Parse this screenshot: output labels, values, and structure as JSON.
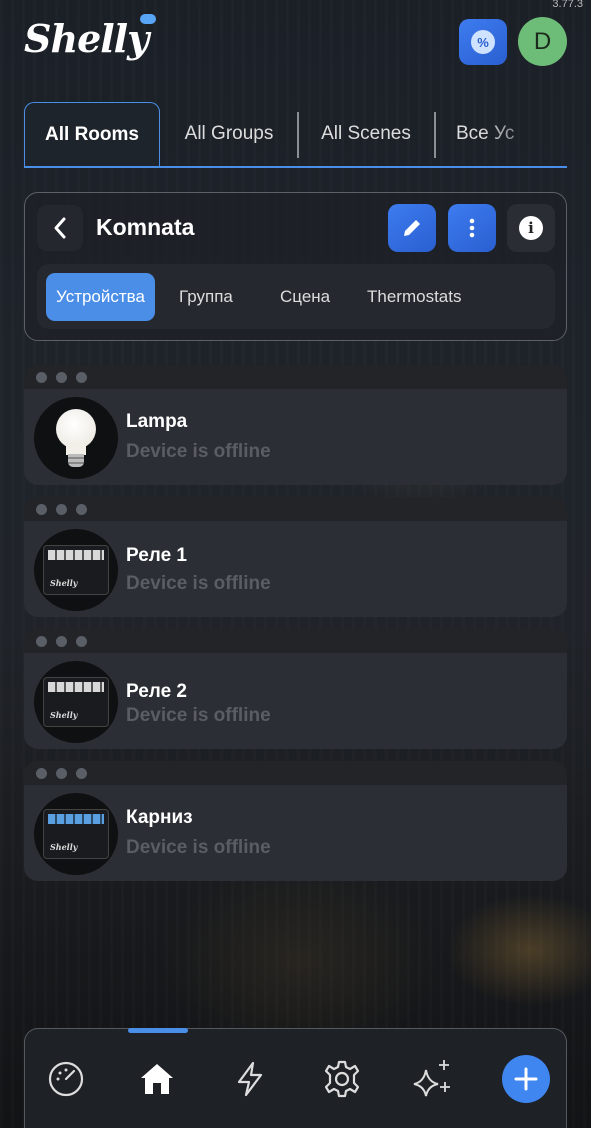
{
  "app": {
    "version": "3.77.3",
    "logo_text": "Shelly",
    "avatar_letter": "D"
  },
  "tabs": [
    {
      "label": "All Rooms"
    },
    {
      "label": "All Groups"
    },
    {
      "label": "All Scenes"
    },
    {
      "label": "Все Ус"
    }
  ],
  "room": {
    "title": "Komnata",
    "subtabs": [
      {
        "label": "Устройства"
      },
      {
        "label": "Группа"
      },
      {
        "label": "Сцена"
      },
      {
        "label": "Thermostats"
      }
    ]
  },
  "devices": [
    {
      "name": "Lampa",
      "status": "Device is offline",
      "image": "bulb-image"
    },
    {
      "name": "Реле 1",
      "status": "Device is offline",
      "image": "relay-image"
    },
    {
      "name": "Реле 2",
      "status": "Device is offline",
      "image": "relay-image"
    },
    {
      "name": "Карниз",
      "status": "Device is offline",
      "image": "shutter-relay-image"
    }
  ],
  "nav": {
    "items": [
      "dashboard-icon",
      "home-icon",
      "lightning-icon",
      "settings-icon",
      "sparkle-icon",
      "add-icon"
    ],
    "active": "home-icon"
  },
  "colors": {
    "accent": "#4b8ee8",
    "offline": "#5a5d63",
    "avatar": "#6dbd78"
  }
}
